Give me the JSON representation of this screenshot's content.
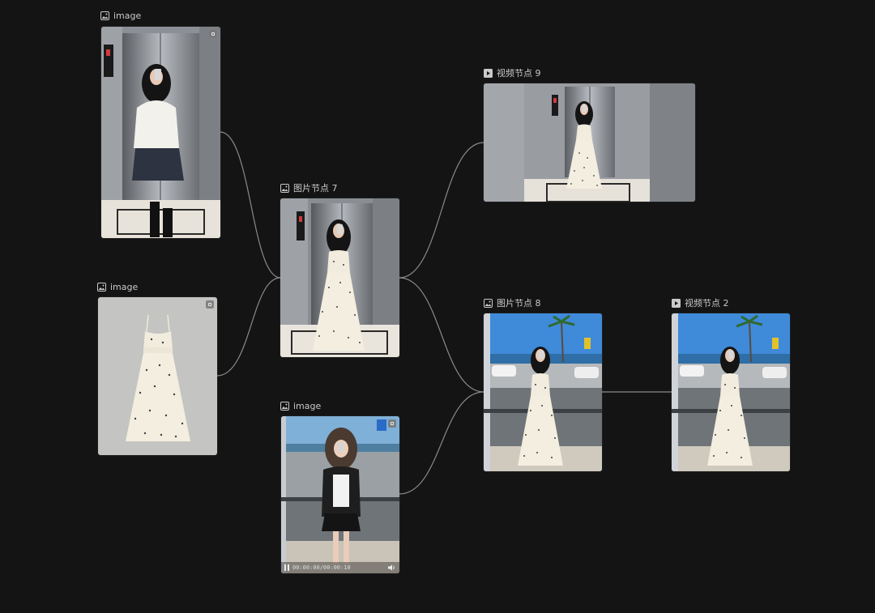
{
  "nodes": {
    "image_top": {
      "label": "image",
      "type_icon": "image-icon"
    },
    "image_dress": {
      "label": "image",
      "type_icon": "image-icon"
    },
    "image_bottom": {
      "label": "image",
      "type_icon": "image-icon",
      "video_time": "00:00:00/00:00:10"
    },
    "node7": {
      "label": "图片节点 7",
      "type_icon": "image-icon"
    },
    "node8": {
      "label": "图片节点 8",
      "type_icon": "image-icon"
    },
    "node9": {
      "label": "视频节点 9",
      "type_icon": "video-icon"
    },
    "node2": {
      "label": "视频节点 2",
      "type_icon": "video-icon"
    }
  },
  "edges": [
    {
      "from": "image_top",
      "to": "node7"
    },
    {
      "from": "image_dress",
      "to": "node7"
    },
    {
      "from": "node7",
      "to": "node9"
    },
    {
      "from": "node7",
      "to": "node8"
    },
    {
      "from": "image_bottom",
      "to": "node8"
    },
    {
      "from": "node8",
      "to": "node2"
    }
  ],
  "colors": {
    "background": "#141414",
    "edge": "#8a8a8a",
    "label_text": "#c9c9c9"
  }
}
